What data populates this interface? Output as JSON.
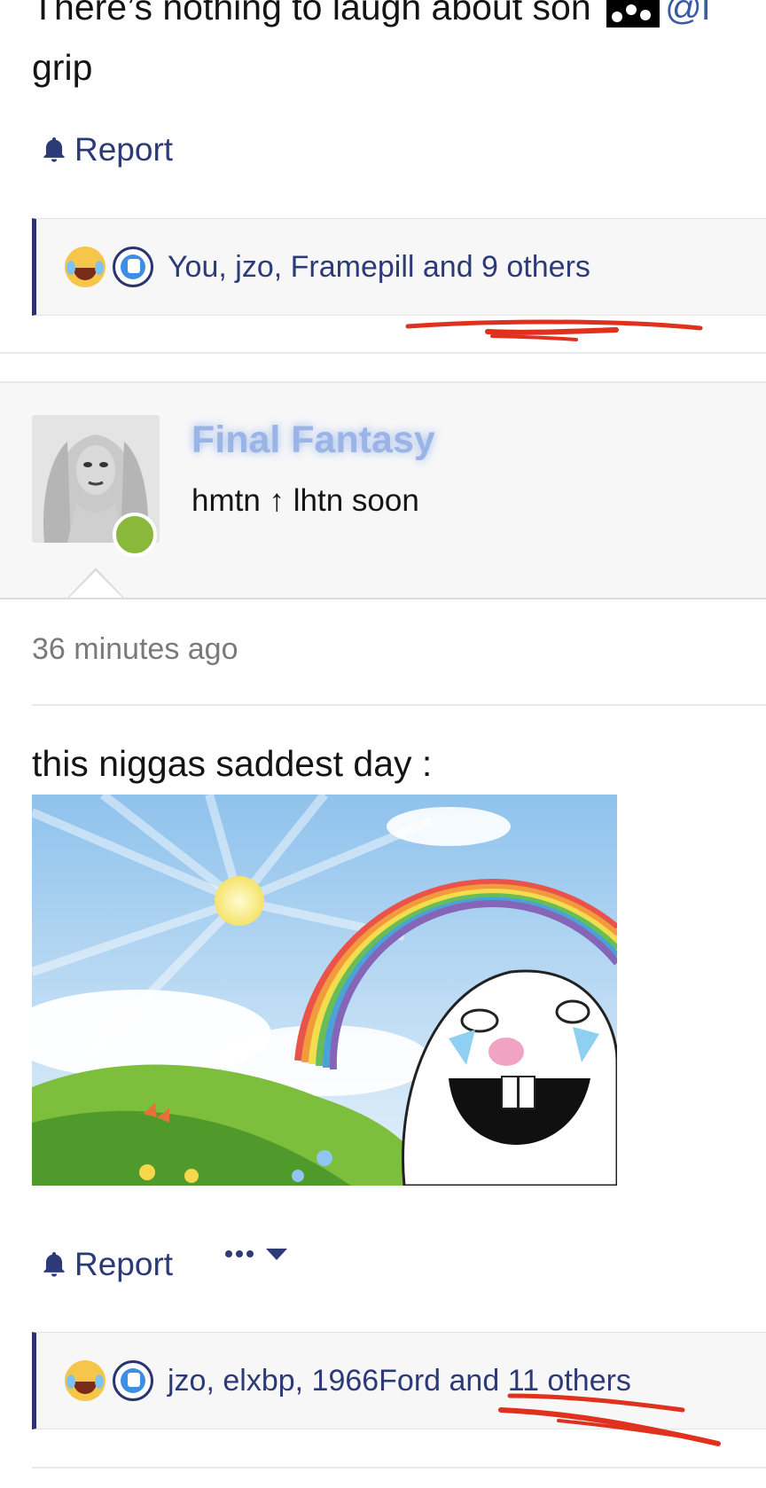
{
  "previous_post": {
    "text_start": "There’s nothing to laugh about son",
    "mention": "@l",
    "text_end": "grip",
    "report_label": "Report",
    "reactions_text": "You, jzo, Framepill and 9 others"
  },
  "post": {
    "author": {
      "name": "Final Fantasy",
      "title": "hmtn ↑ lhtn soon",
      "online": true
    },
    "timestamp": "36 minutes ago",
    "text": "this niggas saddest day :",
    "image_description_icon": "crying-bunny-rainbow-image",
    "report_label": "Report",
    "reactions_text": "jzo, elxbp, 1966Ford and 11 others"
  },
  "colors": {
    "link": "#2c3a78",
    "username": "#9ab4e6",
    "online": "#8ab83a",
    "annotation": "#e0301e"
  }
}
